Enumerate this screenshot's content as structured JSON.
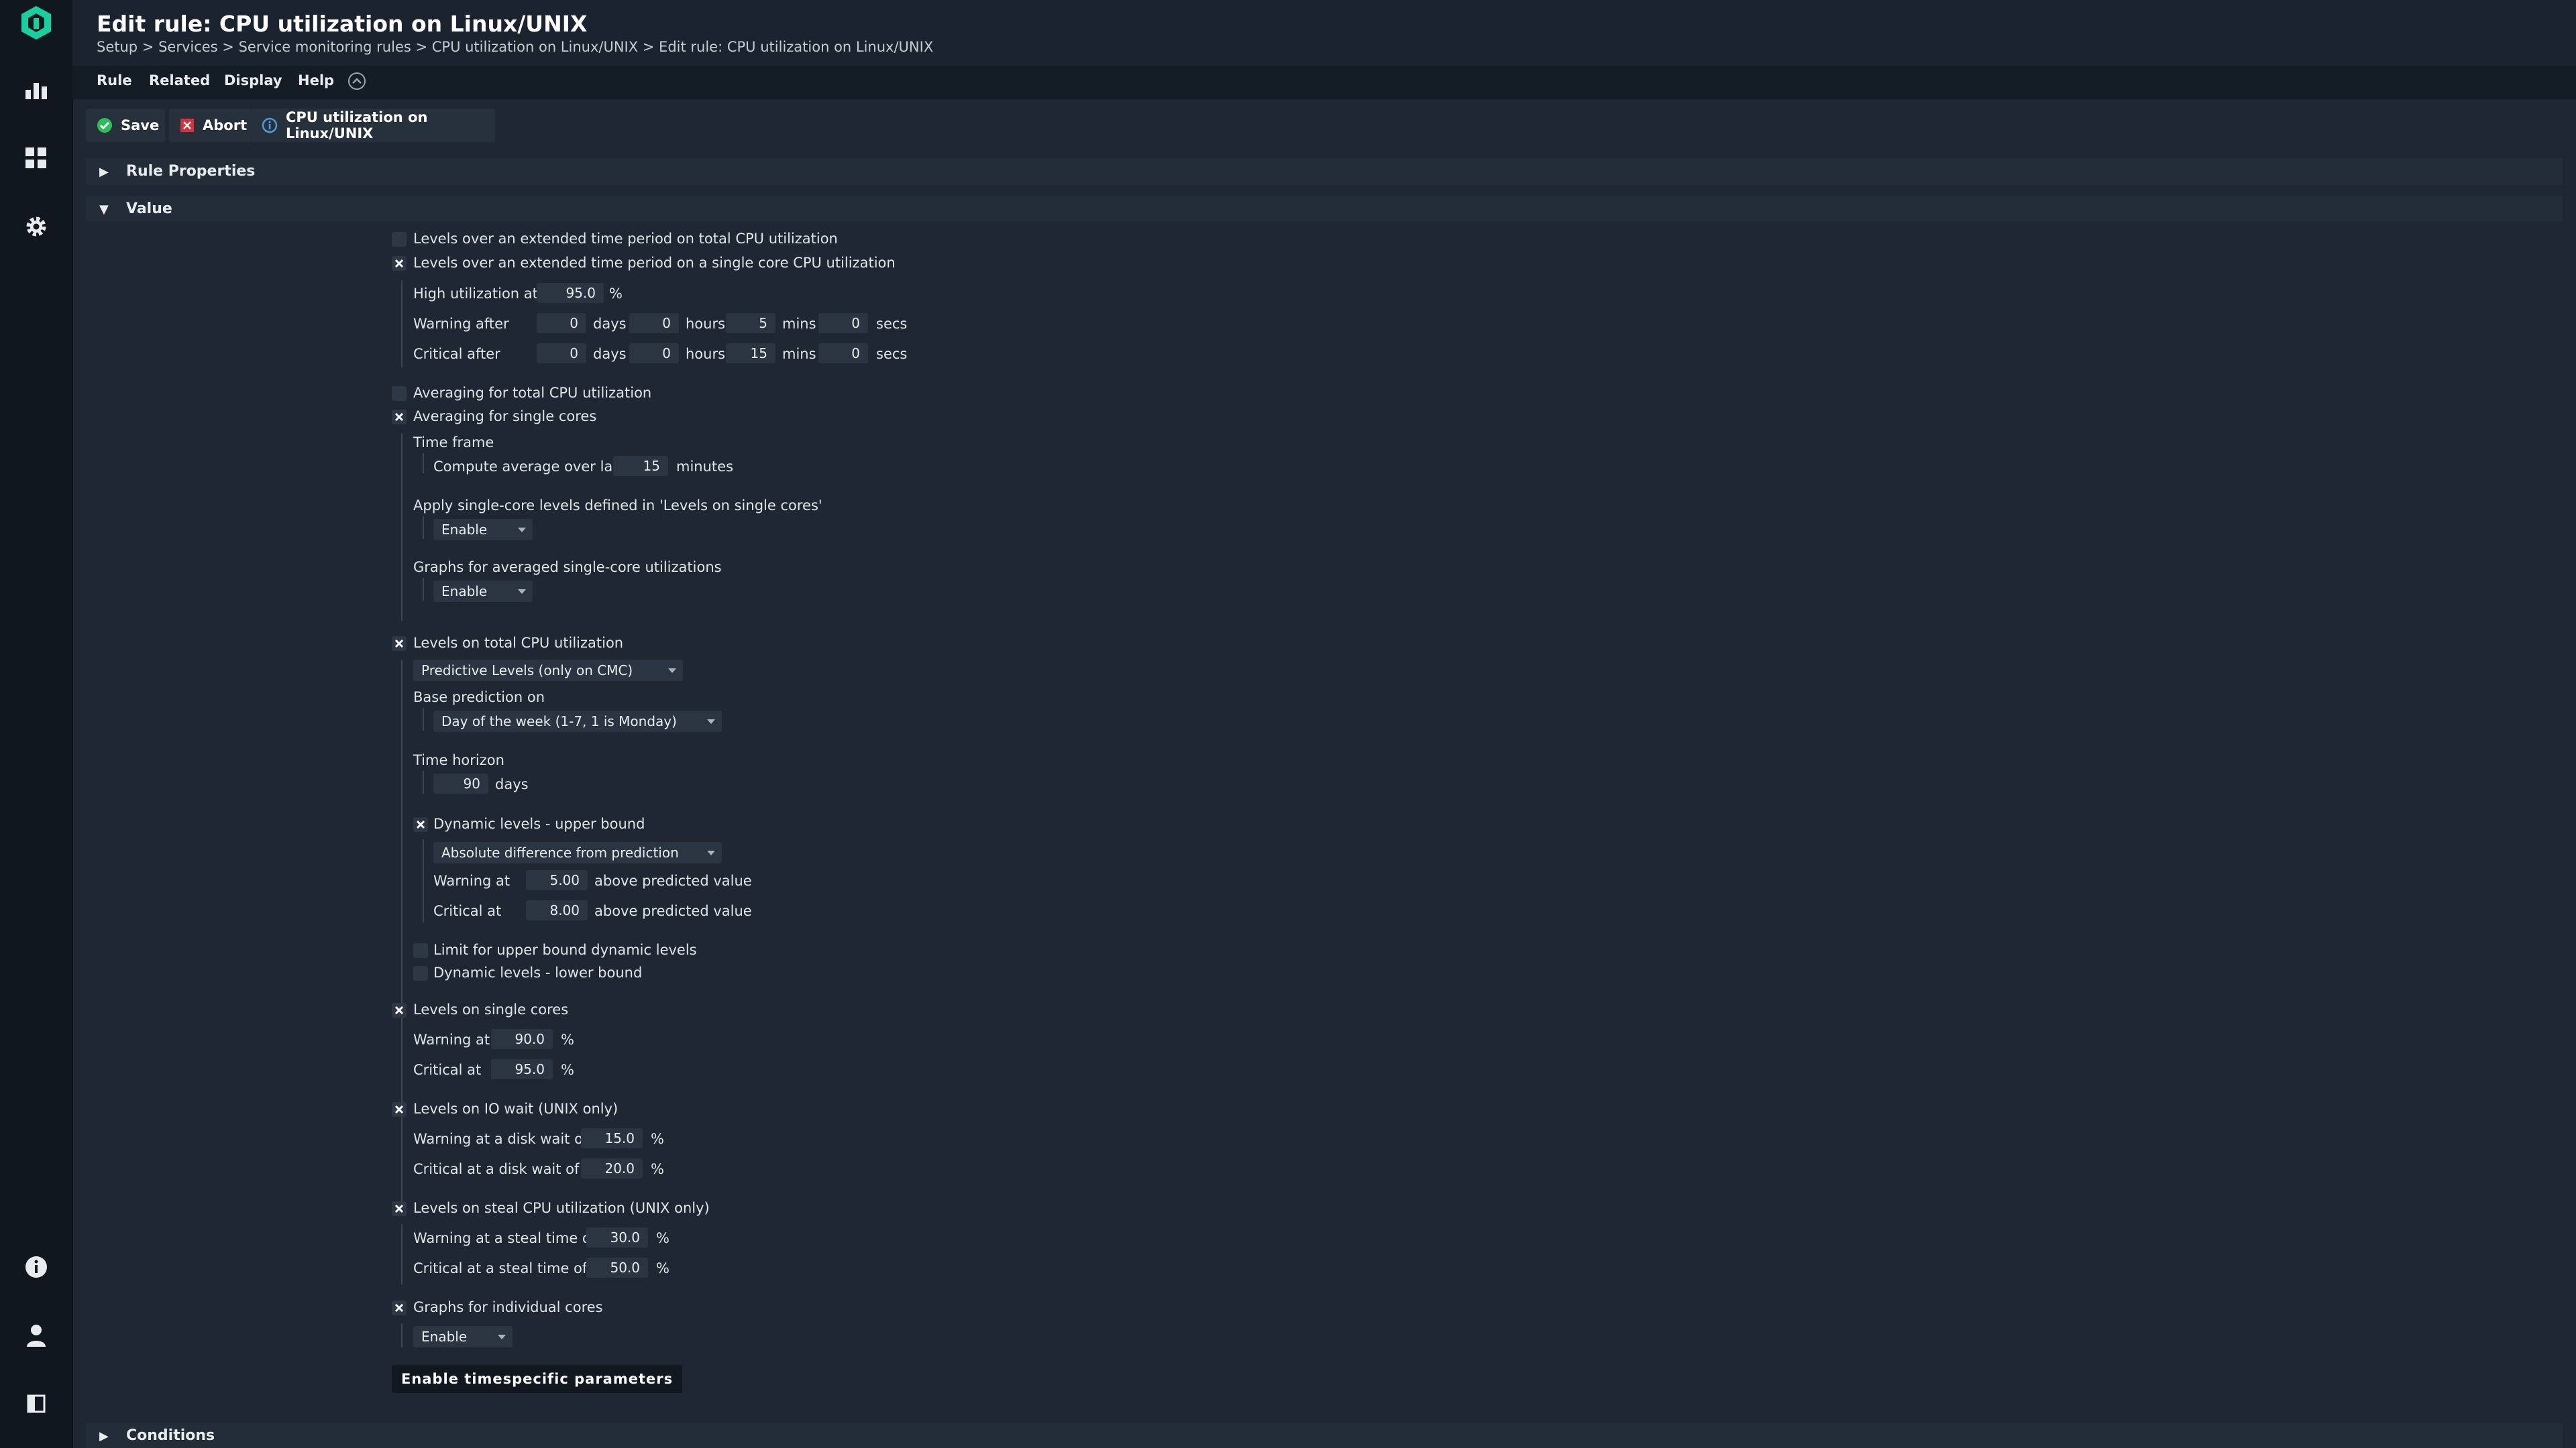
{
  "header": {
    "title": "Edit rule: CPU utilization on Linux/UNIX",
    "breadcrumb": "Setup > Services > Service monitoring rules > CPU utilization on Linux/UNIX > Edit rule: CPU utilization on Linux/UNIX"
  },
  "menu": {
    "rule": "Rule",
    "related": "Related",
    "display": "Display",
    "help": "Help"
  },
  "toolbar": {
    "save": "Save",
    "abort": "Abort",
    "rule_ref": "CPU utilization on Linux/UNIX"
  },
  "sections": {
    "rule_properties": "Rule Properties",
    "value": "Value",
    "conditions": "Conditions"
  },
  "form": {
    "ext_total": "Levels over an extended time period on total CPU utilization",
    "ext_single": "Levels over an extended time period on a single core CPU utilization",
    "high_util_label": "High utilization at",
    "high_util_value": "95.0",
    "pct": "%",
    "warning_after": "Warning after",
    "critical_after": "Critical after",
    "days": "days",
    "hours": "hours",
    "mins": "mins",
    "secs": "secs",
    "warn_days": "0",
    "warn_hours": "0",
    "warn_mins": "5",
    "warn_secs": "0",
    "crit_days": "0",
    "crit_hours": "0",
    "crit_mins": "15",
    "crit_secs": "0",
    "avg_total": "Averaging for total CPU utilization",
    "avg_single": "Averaging for single cores",
    "time_frame": "Time frame",
    "compute_avg": "Compute average over last",
    "compute_avg_value": "15",
    "minutes": "minutes",
    "apply_single": "Apply single-core levels defined in 'Levels on single cores'",
    "apply_single_value": "Enable",
    "graphs_avg": "Graphs for averaged single-core utilizations",
    "graphs_avg_value": "Enable",
    "levels_total": "Levels on total CPU utilization",
    "levels_total_value": "Predictive Levels (only on CMC)",
    "base_prediction": "Base prediction on",
    "base_prediction_value": "Day of the week (1-7, 1 is Monday)",
    "time_horizon": "Time horizon",
    "time_horizon_value": "90",
    "dyn_upper": "Dynamic levels - upper bound",
    "dyn_upper_value": "Absolute difference from prediction",
    "warning_at": "Warning at",
    "critical_at": "Critical at",
    "dyn_warn_value": "5.00",
    "dyn_crit_value": "8.00",
    "above_pred": "above predicted value",
    "limit_upper": "Limit for upper bound dynamic levels",
    "dyn_lower": "Dynamic levels - lower bound",
    "levels_single": "Levels on single cores",
    "single_warn": "90.0",
    "single_crit": "95.0",
    "levels_io": "Levels on IO wait (UNIX only)",
    "io_warn_label": "Warning at a disk wait of",
    "io_crit_label": "Critical at a disk wait of",
    "io_warn": "15.0",
    "io_crit": "20.0",
    "levels_steal": "Levels on steal CPU utilization (UNIX only)",
    "steal_warn_label": "Warning at a steal time of",
    "steal_crit_label": "Critical at a steal time of",
    "steal_warn": "30.0",
    "steal_crit": "50.0",
    "graphs_cores": "Graphs for individual cores",
    "graphs_cores_value": "Enable",
    "timespecific": "Enable timespecific parameters"
  },
  "colors": {
    "brand": "#15d1a0",
    "save_icon": "#2bbf57",
    "abort_icon": "#d8313c",
    "info_icon": "#4a9bd8"
  },
  "icons": [
    "brand-logo-icon",
    "monitor-icon",
    "dashboard-icon",
    "gear-icon",
    "info-icon",
    "user-icon",
    "sidebar-toggle-icon",
    "save-check-icon",
    "abort-x-icon",
    "help-circle-icon",
    "collapse-up-icon"
  ]
}
